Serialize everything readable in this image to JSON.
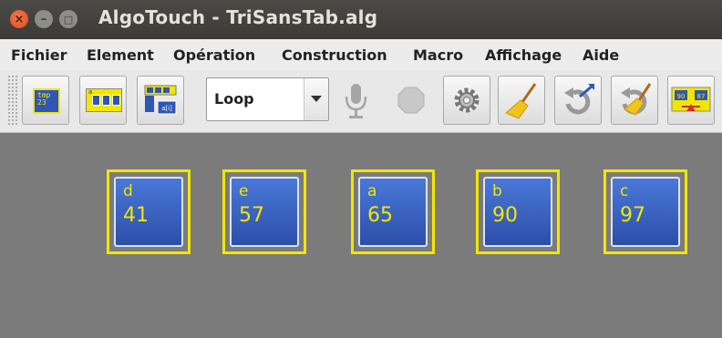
{
  "window": {
    "title": "AlgoTouch - TriSansTab.alg",
    "close_glyph": "×",
    "min_glyph": "–",
    "max_glyph": "□"
  },
  "menu": [
    "Fichier",
    "Element",
    "Opération",
    "Construction",
    "Macro",
    "Affichage",
    "Aide"
  ],
  "toolbar": {
    "variable_icon": {
      "line1": "tmp",
      "line2": "23"
    },
    "array_icon": {
      "top_label": "a",
      "cells": [
        "a[i]",
        "a[j]"
      ]
    },
    "index_icon": {
      "cell": "a[i]"
    },
    "loop_select": {
      "value": "Loop"
    },
    "buttons": [
      "microphone-icon",
      "stop-icon",
      "gear-icon",
      "broom-icon",
      "undo-icon",
      "clear-undo-icon",
      "swap-icon"
    ],
    "swap_icon": {
      "left": "90",
      "right": "87"
    }
  },
  "variables": [
    {
      "name": "d",
      "value": "41"
    },
    {
      "name": "e",
      "value": "57"
    },
    {
      "name": "a",
      "value": "65"
    },
    {
      "name": "b",
      "value": "90"
    },
    {
      "name": "c",
      "value": "97"
    }
  ],
  "colors": {
    "titlebar": "#3d3c39",
    "accent_yellow": "#f2e600",
    "tile_blue": "#2f56b5",
    "workspace": "#7b7b7b"
  }
}
